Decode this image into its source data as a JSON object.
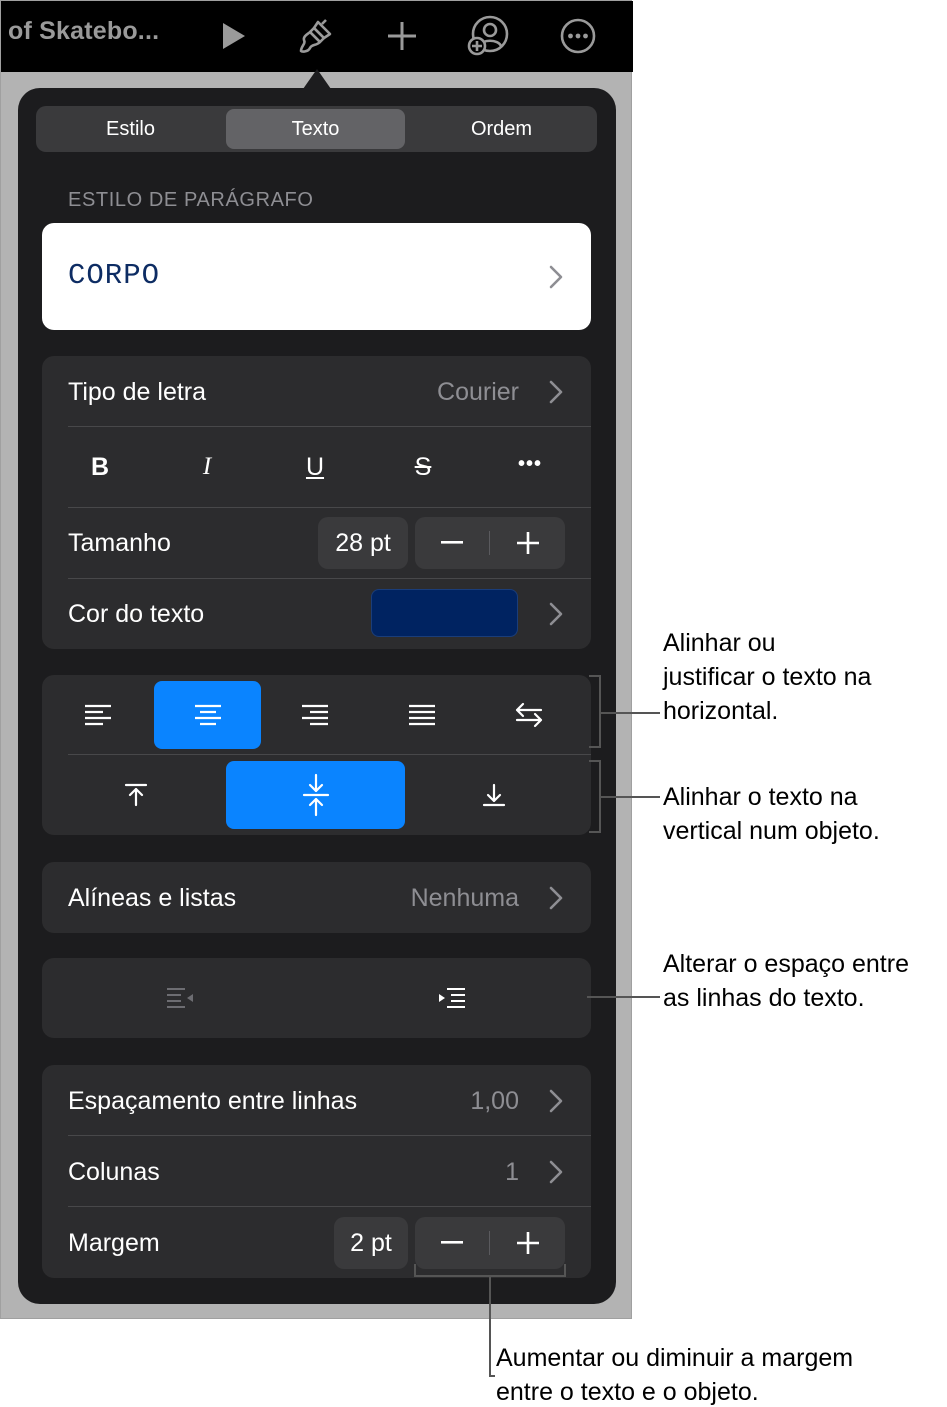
{
  "toolbar": {
    "document_title": "of Skatebo...",
    "icons": [
      "play-icon",
      "paintbrush-icon",
      "plus-icon",
      "collaborate-icon",
      "more-icon"
    ]
  },
  "tabs": [
    {
      "label": "Estilo",
      "active": false
    },
    {
      "label": "Texto",
      "active": true
    },
    {
      "label": "Ordem",
      "active": false
    }
  ],
  "paragraph_style": {
    "section_label": "ESTILO DE PARÁGRAFO",
    "name": "CORPO"
  },
  "font": {
    "label": "Tipo de letra",
    "value": "Courier",
    "format_buttons": [
      "B",
      "I",
      "U",
      "S",
      "•••"
    ],
    "size_label": "Tamanho",
    "size_value": "28 pt",
    "color_label": "Cor do texto",
    "color_value": "#002361"
  },
  "alignment": {
    "horizontal_selected": 1,
    "vertical_selected": 1
  },
  "bullets": {
    "label": "Alíneas e listas",
    "value": "Nenhuma"
  },
  "spacing": {
    "line_spacing_label": "Espaçamento entre linhas",
    "line_spacing_value": "1,00",
    "columns_label": "Colunas",
    "columns_value": "1",
    "margin_label": "Margem",
    "margin_value": "2 pt"
  },
  "callouts": {
    "horizontal": [
      "Alinhar ou",
      "justificar o texto na",
      "horizontal."
    ],
    "vertical": [
      "Alinhar o texto na",
      "vertical num objeto."
    ],
    "indent": [
      "Alterar o espaço entre",
      "as linhas do texto."
    ],
    "margin": [
      "Aumentar ou diminuir a margem",
      "entre o texto e o objeto."
    ]
  },
  "colors": {
    "accent": "#0a84ff",
    "panel": "#1c1c1e",
    "group": "#2c2c2e",
    "style_text": "#0d2c63"
  }
}
